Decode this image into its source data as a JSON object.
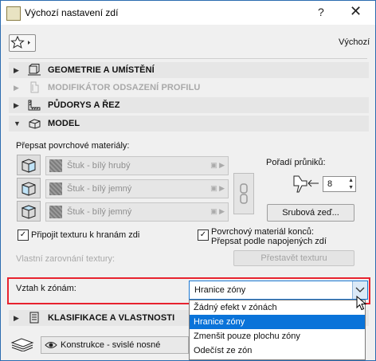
{
  "window": {
    "title": "Výchozí nastavení zdí",
    "help_label": "?",
    "close_label": "✕"
  },
  "toolbar": {
    "favorites_icon": "star-icon",
    "default_label": "Výchozí"
  },
  "sections": [
    {
      "label": "GEOMETRIE A UMÍSTĚNÍ",
      "icon": "geometry-icon",
      "expanded": false,
      "disabled": false
    },
    {
      "label": "MODIFIKÁTOR ODSAZENÍ PROFILU",
      "icon": "profile-icon",
      "expanded": false,
      "disabled": true
    },
    {
      "label": "PŮDORYS A ŘEZ",
      "icon": "floorplan-icon",
      "expanded": false,
      "disabled": false
    },
    {
      "label": "MODEL",
      "icon": "model-icon",
      "expanded": true,
      "disabled": false
    },
    {
      "label": "KLASIFIKACE A VLASTNOSTI",
      "icon": "classification-icon",
      "expanded": false,
      "disabled": false
    }
  ],
  "model": {
    "override_label": "Přepsat povrchové materiály:",
    "materials": [
      {
        "name": "Štuk - bílý hrubý"
      },
      {
        "name": "Štuk - bílý jemný"
      },
      {
        "name": "Štuk - bílý jemný"
      }
    ],
    "intersection_label": "Pořadí průniků:",
    "intersection_value": "8",
    "log_button": "Srubová zeď...",
    "attach_texture_label": "Připojit texturu k hranám zdi",
    "attach_texture_checked": true,
    "end_material_label_1": "Povrchový materiál konců:",
    "end_material_label_2": "Přepsat podle napojených zdí",
    "end_material_checked": true,
    "custom_alignment_label": "Vlastní zarovnání textury:",
    "reset_texture_button": "Přestavět texturu"
  },
  "zone": {
    "label": "Vztah k zónám:",
    "selected": "Hranice zóny",
    "options": [
      "Žádný efekt v zónách",
      "Hranice zóny",
      "Zmenšit pouze plochu zóny",
      "Odečíst ze zón"
    ],
    "selected_index": 1
  },
  "footer": {
    "layer_value": "Konstrukce - svislé nosné"
  },
  "colors": {
    "highlight_border": "#e8232f",
    "selection": "#0a73d9"
  }
}
